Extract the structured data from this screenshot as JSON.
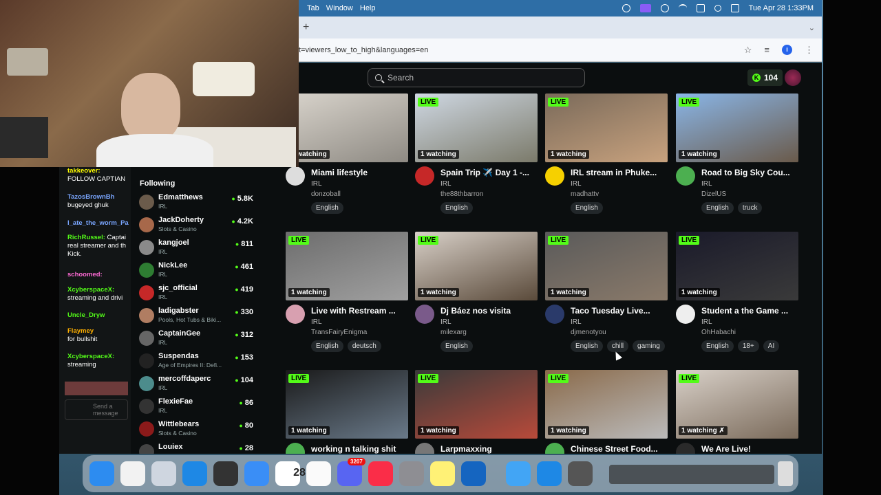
{
  "menubar": {
    "items": [
      "Tab",
      "Window",
      "Help"
    ],
    "datetime": "Tue Apr 28  1:33PM"
  },
  "browser": {
    "url": "t=viewers_low_to_high&languages=en",
    "new_tab": "+",
    "profile_initial": "i"
  },
  "header": {
    "search_placeholder": "Search",
    "kick_points": "104"
  },
  "following": {
    "title": "Following",
    "items": [
      {
        "name": "Edmatthews",
        "category": "IRL",
        "viewers": "5.8K",
        "color": "#6b5b4b"
      },
      {
        "name": "JackDoherty",
        "category": "Slots & Casino",
        "viewers": "4.2K",
        "color": "#a7684a"
      },
      {
        "name": "kangjoel",
        "category": "IRL",
        "viewers": "811",
        "color": "#8a8a8a"
      },
      {
        "name": "NickLee",
        "category": "IRL",
        "viewers": "461",
        "color": "#2e7d32"
      },
      {
        "name": "sjc_official",
        "category": "IRL",
        "viewers": "419",
        "color": "#c62828"
      },
      {
        "name": "ladigabster",
        "category": "Pools, Hot Tubs & Biki...",
        "viewers": "330",
        "color": "#b07d62"
      },
      {
        "name": "CaptainGee",
        "category": "IRL",
        "viewers": "312",
        "color": "#666"
      },
      {
        "name": "Suspendas",
        "category": "Age of Empires II: Defi...",
        "viewers": "153",
        "color": "#222"
      },
      {
        "name": "mercoffdaperc",
        "category": "IRL",
        "viewers": "104",
        "color": "#4c8c8c"
      },
      {
        "name": "FlexieFae",
        "category": "IRL",
        "viewers": "86",
        "color": "#333"
      },
      {
        "name": "Wittlebears",
        "category": "Slots & Casino",
        "viewers": "80",
        "color": "#8b1a1a"
      },
      {
        "name": "Louiex",
        "category": "",
        "viewers": "28",
        "color": "#444"
      }
    ]
  },
  "chat": {
    "lines": [
      {
        "user": "takkeover:",
        "text": "FOLLOW CAPTIAN"
      },
      {
        "user": "TazosBrownBh",
        "text": "bugeyed ghuk"
      },
      {
        "user": "I_ate_the_worm_Pa",
        "text": ""
      },
      {
        "user": "RichRussel:",
        "text": "Captai real streamer and th Kick."
      },
      {
        "user": "schoomed:",
        "text": ""
      },
      {
        "user": "XcyberspaceX:",
        "text": "streaming and drivi"
      },
      {
        "user": "Uncle_Dryw",
        "text": ""
      },
      {
        "user": "Flaymey",
        "text": "for bullshit"
      },
      {
        "user": "XcyberspaceX:",
        "text": "streaming"
      }
    ],
    "send_placeholder": "Send a message"
  },
  "streams": [
    {
      "title": "Miami lifestyle",
      "category": "IRL",
      "user": "donzoball",
      "tags": [
        "English"
      ],
      "watching": "1 watching",
      "live": "",
      "thumb": [
        "#d9d4cc",
        "#8e8a83"
      ],
      "avatar": "#ddd"
    },
    {
      "title": "Spain Trip ✈️ Day 1 -...",
      "category": "IRL",
      "user": "the88thbarron",
      "tags": [
        "English"
      ],
      "watching": "1 watching",
      "live": "LIVE",
      "thumb": [
        "#cfd8e3",
        "#7b7a6a"
      ],
      "avatar": "#c62828"
    },
    {
      "title": "IRL stream in Phuke...",
      "category": "IRL",
      "user": "madhattv",
      "tags": [
        "English"
      ],
      "watching": "1 watching",
      "live": "LIVE",
      "thumb": [
        "#7a6a5a",
        "#c8a27e"
      ],
      "avatar": "#f6d000"
    },
    {
      "title": "Road to Big Sky Cou...",
      "category": "IRL",
      "user": "DizelUS",
      "tags": [
        "English",
        "truck"
      ],
      "watching": "1 watching",
      "live": "LIVE",
      "thumb": [
        "#8ab6e8",
        "#6a5a4a"
      ],
      "avatar": "#4caf50"
    },
    {
      "title": "Live with Restream ...",
      "category": "IRL",
      "user": "TransFairyEnigma",
      "tags": [
        "English",
        "deutsch"
      ],
      "watching": "1 watching",
      "live": "LIVE",
      "thumb": [
        "#6d6d6d",
        "#a0a0a0"
      ],
      "avatar": "#d8a0b0"
    },
    {
      "title": "Dj Báez nos visita",
      "category": "IRL",
      "user": "milexarg",
      "tags": [
        "English"
      ],
      "watching": "1 watching",
      "live": "LIVE",
      "thumb": [
        "#d8d0c8",
        "#5a4a3a"
      ],
      "avatar": "#7a5a8a"
    },
    {
      "title": "Taco Tuesday Live...",
      "category": "IRL",
      "user": "djmenotyou",
      "tags": [
        "English",
        "chill",
        "gaming"
      ],
      "watching": "1 watching",
      "live": "LIVE",
      "thumb": [
        "#5a5a5a",
        "#8a7a6a"
      ],
      "avatar": "#2a3a6a"
    },
    {
      "title": "Student a the Game ...",
      "category": "IRL",
      "user": "OhHabachi",
      "tags": [
        "English",
        "18+",
        "AI"
      ],
      "watching": "1 watching",
      "live": "LIVE",
      "thumb": [
        "#1a1a2a",
        "#3a3a3a"
      ],
      "avatar": "#eee"
    },
    {
      "title": "working n talking shit",
      "category": "",
      "user": "",
      "tags": [],
      "watching": "1 watching",
      "live": "LIVE",
      "thumb": [
        "#1a1a1a",
        "#6a7a8a"
      ],
      "avatar": "#4caf50"
    },
    {
      "title": "Larpmaxxing",
      "category": "",
      "user": "",
      "tags": [],
      "watching": "1 watching",
      "live": "LIVE",
      "thumb": [
        "#3a3a3a",
        "#b84a3a"
      ],
      "avatar": "#777"
    },
    {
      "title": "Chinese Street Food...",
      "category": "",
      "user": "",
      "tags": [],
      "watching": "1 watching",
      "live": "LIVE",
      "thumb": [
        "#8a6a4a",
        "#bbb"
      ],
      "avatar": "#4caf50"
    },
    {
      "title": "We Are Live!",
      "category": "",
      "user": "",
      "tags": [],
      "watching": "1 watching ✗",
      "live": "LIVE",
      "thumb": [
        "#d8d0c8",
        "#7a6a5a"
      ],
      "avatar": "#2a2a2a"
    }
  ],
  "dock": {
    "calendar_day": "28",
    "discord_badge": "3207",
    "icons": [
      "finder-icon",
      "chrome-icon",
      "launchpad-icon",
      "safari-icon",
      "obs-icon",
      "mail-icon",
      "calendar-icon",
      "photos-icon",
      "discord-icon",
      "music-icon",
      "settings-icon",
      "notes-icon",
      "files-icon",
      "preview-icon",
      "quicktime-icon",
      "calculator-icon"
    ]
  },
  "colors": {
    "kick_green": "#53fc18",
    "menubar_blue": "#2e6ea6",
    "page_bg": "#0b0e0f"
  }
}
